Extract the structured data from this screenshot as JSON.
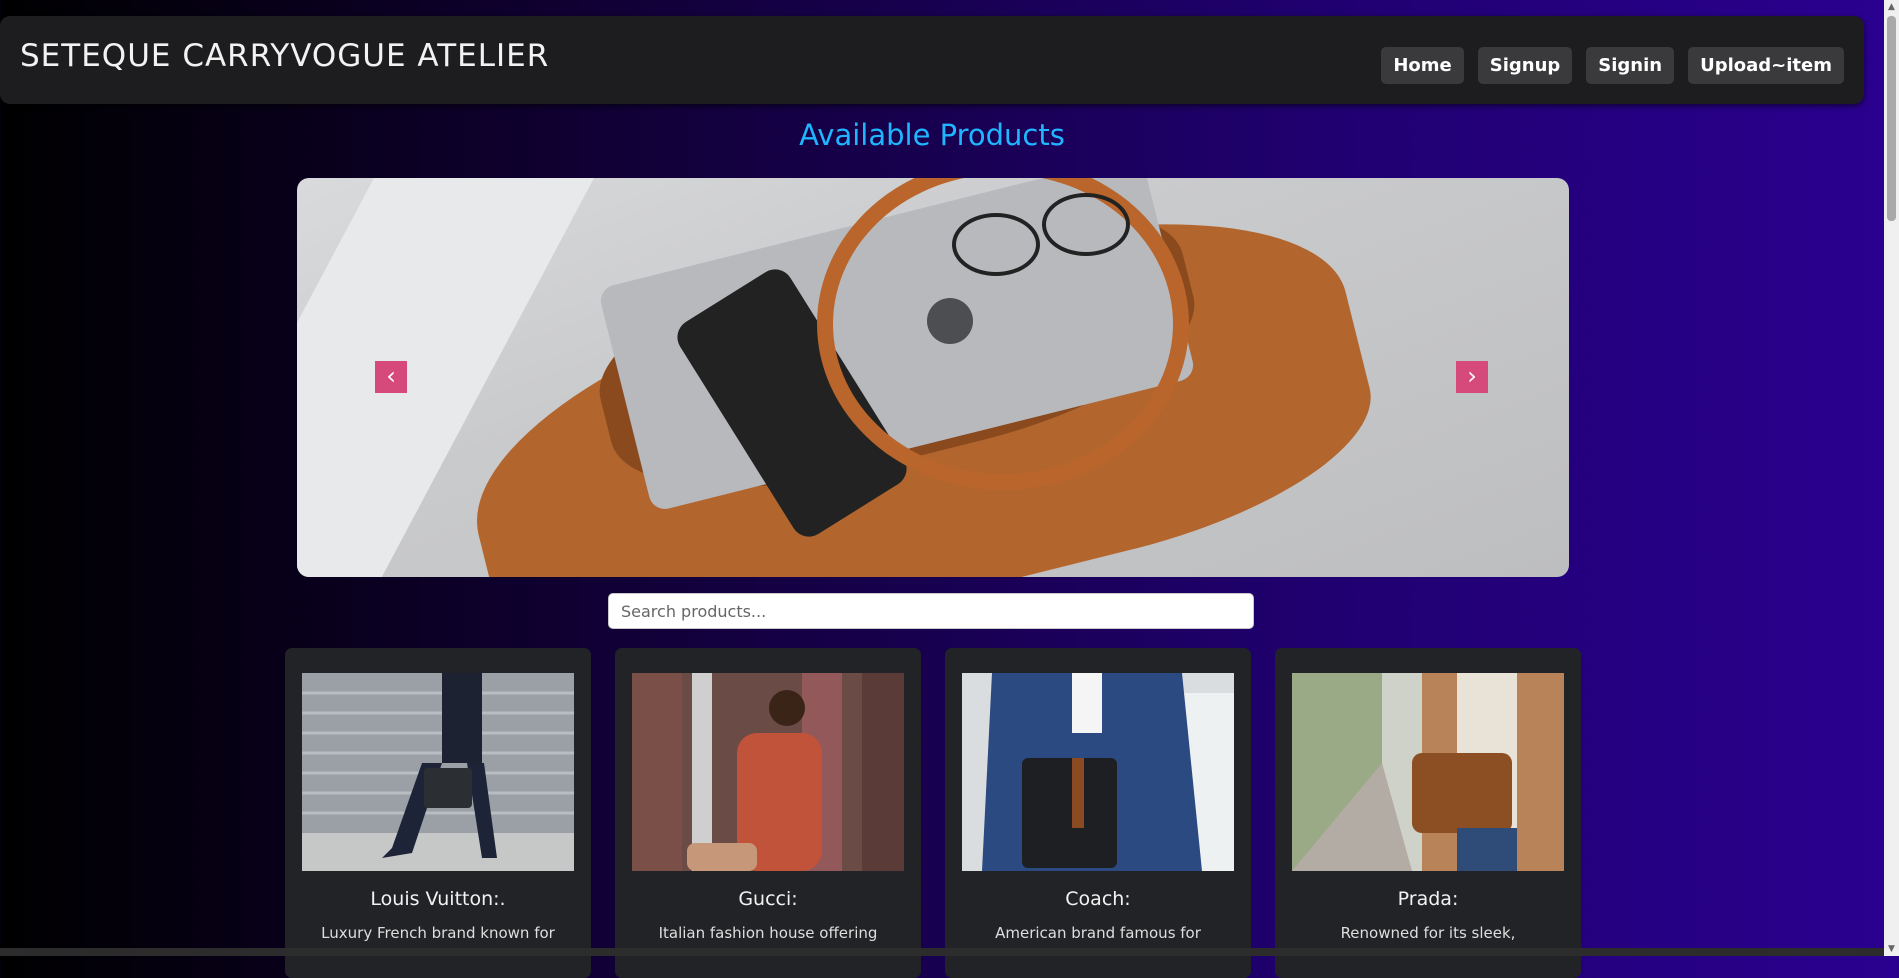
{
  "navbar": {
    "brand": "SETEQUE CARRYVOGUE ATELIER",
    "links": [
      "Home",
      "Signup",
      "Signin",
      "Upload~item"
    ]
  },
  "page": {
    "heading": "Available Products",
    "heading_color": "#1fb6ff"
  },
  "carousel": {
    "prev_icon": "chevron-left-icon",
    "next_icon": "chevron-right-icon",
    "arrow_color": "#d54a7a"
  },
  "search": {
    "placeholder": "Search products..."
  },
  "products": [
    {
      "name": "Louis Vuitton:.",
      "desc": "Luxury French brand known for"
    },
    {
      "name": "Gucci:",
      "desc": "Italian fashion house offering"
    },
    {
      "name": "Coach:",
      "desc": "American brand famous for"
    },
    {
      "name": "Prada:",
      "desc": "Renowned for its sleek,"
    }
  ]
}
